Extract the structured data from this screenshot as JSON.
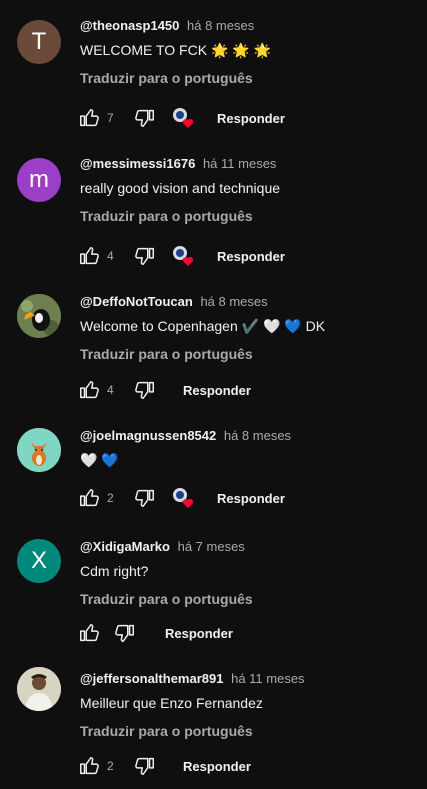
{
  "ui": {
    "translate_label": "Traduzir para o português",
    "reply_label": "Responder"
  },
  "comments": [
    {
      "handle": "@theonasp1450",
      "time": "há 8 meses",
      "text": "WELCOME TO FCK 🌟 🌟 🌟",
      "likes": "7",
      "avatar_letter": "T",
      "avatar_color": "#6b4a3a",
      "creator_heart": true
    },
    {
      "handle": "@messimessi1676",
      "time": "há 11 meses",
      "text": "really good vision and technique",
      "likes": "4",
      "avatar_letter": "m",
      "avatar_color": "#9c3fc7",
      "creator_heart": true
    },
    {
      "handle": "@DeffoNotToucan",
      "time": "há 8 meses",
      "text": "Welcome to Copenhagen ✔️ 🤍 💙 DK",
      "likes": "4",
      "avatar_letter": "",
      "avatar_color": "#5a6b45",
      "creator_heart": false
    },
    {
      "handle": "@joelmagnussen8542",
      "time": "há 8 meses",
      "text": "🤍 💙",
      "likes": "2",
      "avatar_letter": "",
      "avatar_color": "#7fd6c2",
      "creator_heart": true
    },
    {
      "handle": "@XidigaMarko",
      "time": "há 7 meses",
      "text": "Cdm right?",
      "likes": "",
      "avatar_letter": "X",
      "avatar_color": "#00897b",
      "creator_heart": false
    },
    {
      "handle": "@jeffersonalthemar891",
      "time": "há 11 meses",
      "text": "Meilleur que Enzo Fernandez",
      "likes": "2",
      "avatar_letter": "",
      "avatar_color": "#c9c2b0",
      "creator_heart": false
    }
  ],
  "colors": {
    "background": "#0f0f0f",
    "text_primary": "#f1f1f1",
    "text_secondary": "#aaaaaa",
    "heart": "#ff0033"
  }
}
